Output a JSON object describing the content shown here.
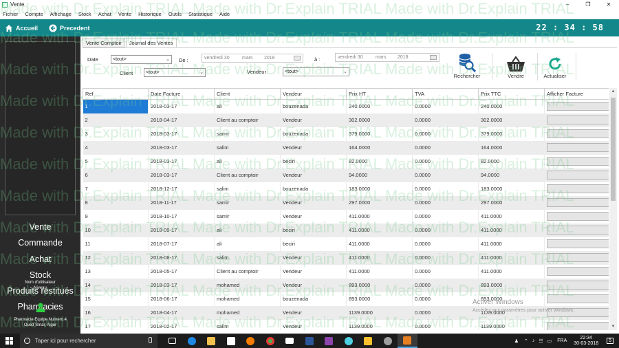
{
  "window": {
    "title": "Vente"
  },
  "menu": [
    "Fichier",
    "Compte",
    "Affichage",
    "Stock",
    "Achat",
    "Vente",
    "Historique",
    "Outils",
    "Statistique",
    "Aide"
  ],
  "topbar": {
    "home": "Accueil",
    "back": "Precedent",
    "clock": "22 : 34 : 58"
  },
  "sidebar": {
    "nav": [
      "Vente",
      "Commande",
      "Achat",
      "Stock",
      "Produits restitués",
      "Pharmacies"
    ],
    "user_label": "Nom d'utilisateur",
    "level_label": "Niveau",
    "pharmacy_name": "Pharmacie Equipe Numero 4",
    "pharmacy_address": "Oued Smar, Alger"
  },
  "tabs": [
    {
      "label": "Vente Comptoir"
    },
    {
      "label": "Journal des Ventes"
    }
  ],
  "filters": {
    "date_label": "Date",
    "date_value": "<tout>",
    "from_label": "De :",
    "from_date": {
      "day": "vendredi 30",
      "month": "mars",
      "year": "2018"
    },
    "to_label": "à :",
    "to_date": {
      "day": "vendredi 30",
      "month": "mars",
      "year": "2018"
    },
    "client_label": "Client",
    "client_value": "<tout>",
    "vendeur_label": "Vendeur",
    "vendeur_value": "<tout>"
  },
  "actions": [
    {
      "label": "Rechercher",
      "icon": "search-database-icon"
    },
    {
      "label": "Vendre",
      "icon": "basket-icon"
    },
    {
      "label": "Actualiser",
      "icon": "refresh-icon"
    }
  ],
  "table": {
    "columns": [
      "Ref",
      "Date Facture",
      "Client",
      "Vendeur",
      "Prix HT",
      "TVA",
      "Prix TTC",
      "Afficher Facture"
    ],
    "rows": [
      [
        "1",
        "2018-03-17",
        "ali",
        "bouzenada",
        "240.0000",
        "0.0000",
        "240.0000"
      ],
      [
        "2",
        "2018-04-17",
        "Client au comptoir",
        "Vendeur",
        "302.0000",
        "0.0000",
        "302.0000"
      ],
      [
        "3",
        "2018-03-17",
        "samir",
        "bouzenada",
        "379.0000",
        "0.0000",
        "379.0000"
      ],
      [
        "4",
        "2018-03-17",
        "salim",
        "Vendeur",
        "164.0000",
        "0.0000",
        "164.0000"
      ],
      [
        "5",
        "2018-03-17",
        "ali",
        "beciri",
        "82.0000",
        "0.0000",
        "82.0000"
      ],
      [
        "6",
        "2018-03-17",
        "Client au comptoir",
        "Vendeur",
        "94.0000",
        "0.0000",
        "94.0000"
      ],
      [
        "7",
        "2018-12-17",
        "salim",
        "bouzenada",
        "183.0000",
        "0.0000",
        "183.0000"
      ],
      [
        "8",
        "2018-11-17",
        "samir",
        "Vendeur",
        "297.0000",
        "0.0000",
        "297.0000"
      ],
      [
        "9",
        "2018-10-17",
        "samir",
        "Vendeur",
        "411.0000",
        "0.0000",
        "411.0000"
      ],
      [
        "10",
        "2018-09-17",
        "ali",
        "beciri",
        "411.0000",
        "0.0000",
        "411.0000"
      ],
      [
        "11",
        "2018-07-17",
        "ali",
        "beciri",
        "411.0000",
        "0.0000",
        "411.0000"
      ],
      [
        "12",
        "2018-08-17",
        "salim",
        "Vendeur",
        "411.0000",
        "0.0000",
        "411.0000"
      ],
      [
        "13",
        "2018-05-17",
        "Client au comptoir",
        "Vendeur",
        "411.0000",
        "0.0000",
        "411.0000"
      ],
      [
        "14",
        "2018-03-17",
        "mohamed",
        "Vendeur",
        "893.0000",
        "0.0000",
        "893.0000"
      ],
      [
        "15",
        "2018-06-17",
        "mohamed",
        "bouzenada",
        "893.0000",
        "0.0000",
        "893.0000"
      ],
      [
        "16",
        "2018-04-17",
        "mohamed",
        "Vendeur",
        "1139.0000",
        "0.0000",
        "1139.0000"
      ],
      [
        "17",
        "2018-02-17",
        "salim",
        "Vendeur",
        "1139.0000",
        "0.0000",
        "1139.0000"
      ]
    ]
  },
  "watermark": "Made with Dr.Explain TRIAL",
  "activation": {
    "title": "Activer Windows",
    "subtitle": "Accédez aux paramètres pour activer Windows."
  },
  "taskbar": {
    "search_placeholder": "Taper ici pour rechercher",
    "lang": "FRA",
    "time": "22:34",
    "date": "30-03-2018",
    "notifications": "5"
  },
  "colors": {
    "accent": "#14878a",
    "sidebar": "#2a2a2a",
    "selection": "#1e7bd6"
  }
}
